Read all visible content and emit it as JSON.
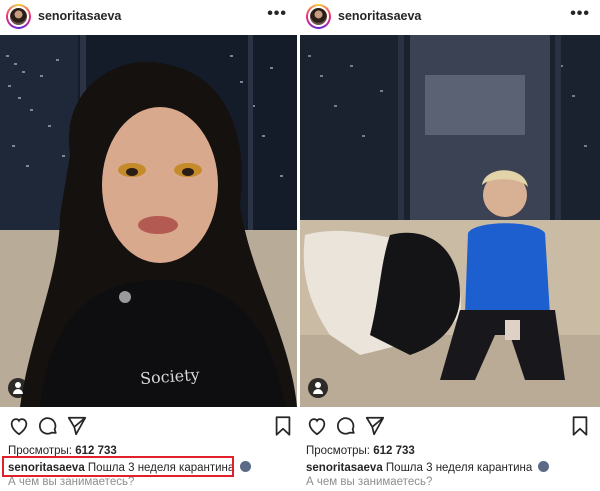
{
  "colors": {
    "highlight": "#e0202a",
    "text": "#262626",
    "muted": "#8e8e8e"
  },
  "posts": [
    {
      "username": "senoritasaeva",
      "more_icon": "more-horizontal-icon",
      "views_label": "Просмотры:",
      "views_count": "612 733",
      "caption_user": "senoritasaeva",
      "caption_text": " Пошла 3 неделя карантина",
      "question": "А чем вы занимаетесь?",
      "highlighted": true,
      "hoodie_text": "Society"
    },
    {
      "username": "senoritasaeva",
      "more_icon": "more-horizontal-icon",
      "views_label": "Просмотры:",
      "views_count": "612 733",
      "caption_user": "senoritasaeva",
      "caption_text": " Пошла 3 неделя карантина",
      "question": "А чем вы занимаетесь?",
      "highlighted": false
    }
  ]
}
